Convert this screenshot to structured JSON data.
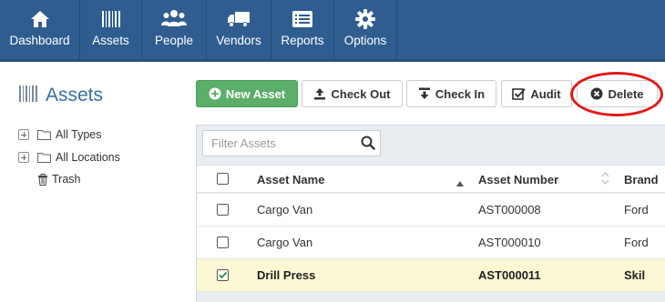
{
  "nav": {
    "items": [
      {
        "label": "Dashboard",
        "icon": "home-icon"
      },
      {
        "label": "Assets",
        "icon": "barcode-icon"
      },
      {
        "label": "People",
        "icon": "people-icon"
      },
      {
        "label": "Vendors",
        "icon": "truck-icon"
      },
      {
        "label": "Reports",
        "icon": "list-icon"
      },
      {
        "label": "Options",
        "icon": "gear-icon"
      }
    ]
  },
  "sidebar": {
    "title": "Assets",
    "tree": [
      {
        "label": "All Types"
      },
      {
        "label": "All Locations"
      },
      {
        "label": "Trash"
      }
    ]
  },
  "toolbar": {
    "new_asset": "New Asset",
    "check_out": "Check Out",
    "check_in": "Check In",
    "audit": "Audit",
    "delete": "Delete"
  },
  "filter": {
    "placeholder": "Filter Assets"
  },
  "table": {
    "columns": [
      "Asset Name",
      "Asset Number",
      "Brand"
    ],
    "rows": [
      {
        "name": "Cargo Van",
        "number": "AST000008",
        "brand": "Ford",
        "checked": false
      },
      {
        "name": "Cargo Van",
        "number": "AST000010",
        "brand": "Ford",
        "checked": false
      },
      {
        "name": "Drill Press",
        "number": "AST000011",
        "brand": "Skil",
        "checked": true
      }
    ]
  },
  "colors": {
    "nav_bg": "#2f5d8f",
    "accent_blue": "#3a6fa3",
    "new_asset_green": "#5cae6b",
    "selected_row": "#fcf8d4",
    "annotation_red": "#e01919"
  }
}
